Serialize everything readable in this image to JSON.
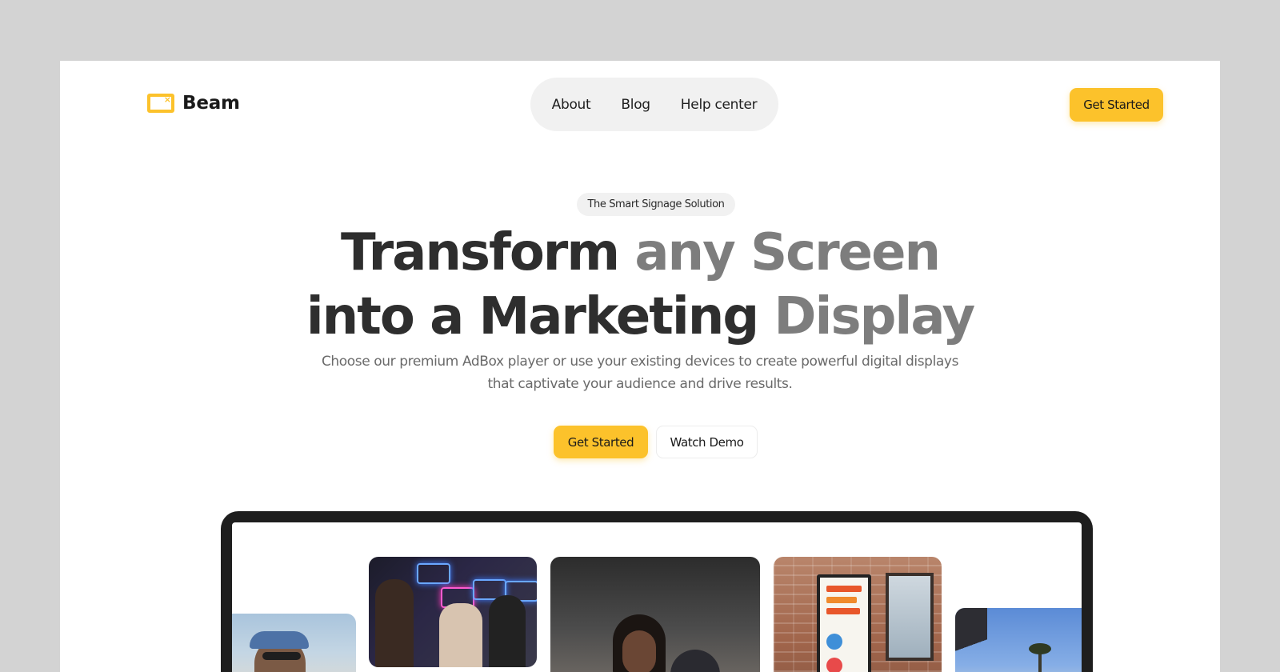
{
  "brand": {
    "name": "Beam",
    "accent": "#fcc22b"
  },
  "nav": {
    "items": [
      {
        "label": "About"
      },
      {
        "label": "Blog"
      },
      {
        "label": "Help center"
      }
    ]
  },
  "header": {
    "cta_label": "Get Started"
  },
  "hero": {
    "badge": "The Smart Signage Solution",
    "headline_line1_dark": "Transform",
    "headline_line1_gray": "any Screen",
    "headline_line2_dark": "into a Marketing",
    "headline_line2_gray": "Display",
    "subtitle": "Choose our premium AdBox player or use your existing devices to create powerful digital displays that captivate your audience and drive results.",
    "primary_cta": "Get Started",
    "secondary_cta": "Watch Demo"
  },
  "mockup": {
    "photos": [
      {
        "name": "photo-woman-cap-sunglasses"
      },
      {
        "name": "photo-store-neon-signs"
      },
      {
        "name": "photo-people-cafe"
      },
      {
        "name": "photo-restaurant-digital-menu"
      },
      {
        "name": "photo-palm-trees-sky"
      }
    ]
  }
}
